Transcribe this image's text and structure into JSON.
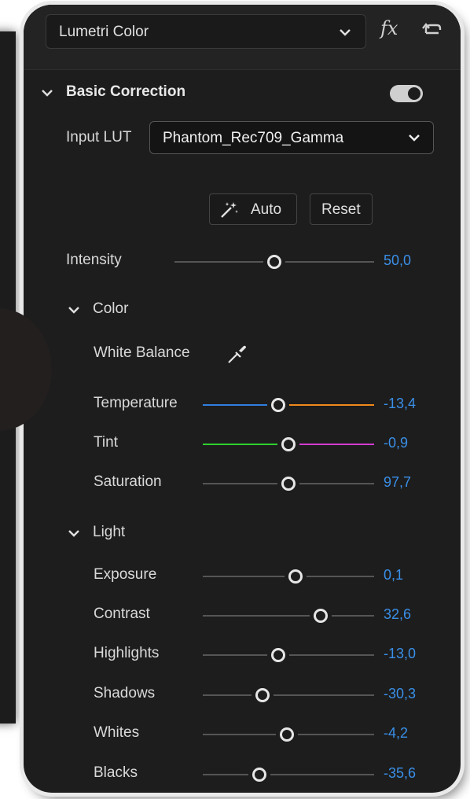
{
  "header": {
    "effect_name": "Lumetri Color",
    "fx_label": "fx"
  },
  "basic": {
    "title": "Basic Correction",
    "toggle_on": true,
    "input_lut_label": "Input LUT",
    "input_lut_value": "Phantom_Rec709_Gamma",
    "auto_label": "Auto",
    "reset_label": "Reset",
    "intensity": {
      "label": "Intensity",
      "value": "50,0",
      "position": 0.5
    }
  },
  "color": {
    "title": "Color",
    "white_balance_label": "White Balance",
    "sliders": [
      {
        "label": "Temperature",
        "value": "-13,4",
        "position": 0.44
      },
      {
        "label": "Tint",
        "value": "-0,9",
        "position": 0.5
      },
      {
        "label": "Saturation",
        "value": "97,7",
        "position": 0.5
      }
    ]
  },
  "light": {
    "title": "Light",
    "sliders": [
      {
        "label": "Exposure",
        "value": "0,1",
        "position": 0.54
      },
      {
        "label": "Contrast",
        "value": "32,6",
        "position": 0.69
      },
      {
        "label": "Highlights",
        "value": "-13,0",
        "position": 0.44
      },
      {
        "label": "Shadows",
        "value": "-30,3",
        "position": 0.35
      },
      {
        "label": "Whites",
        "value": "-4,2",
        "position": 0.49
      },
      {
        "label": "Blacks",
        "value": "-35,6",
        "position": 0.33
      }
    ]
  },
  "colors": {
    "value_blue": "#3a8fe8",
    "temp_cool": "#2f7fe0",
    "temp_warm": "#f08a1c",
    "tint_green": "#2fd02f",
    "tint_magenta": "#d23bd2"
  }
}
